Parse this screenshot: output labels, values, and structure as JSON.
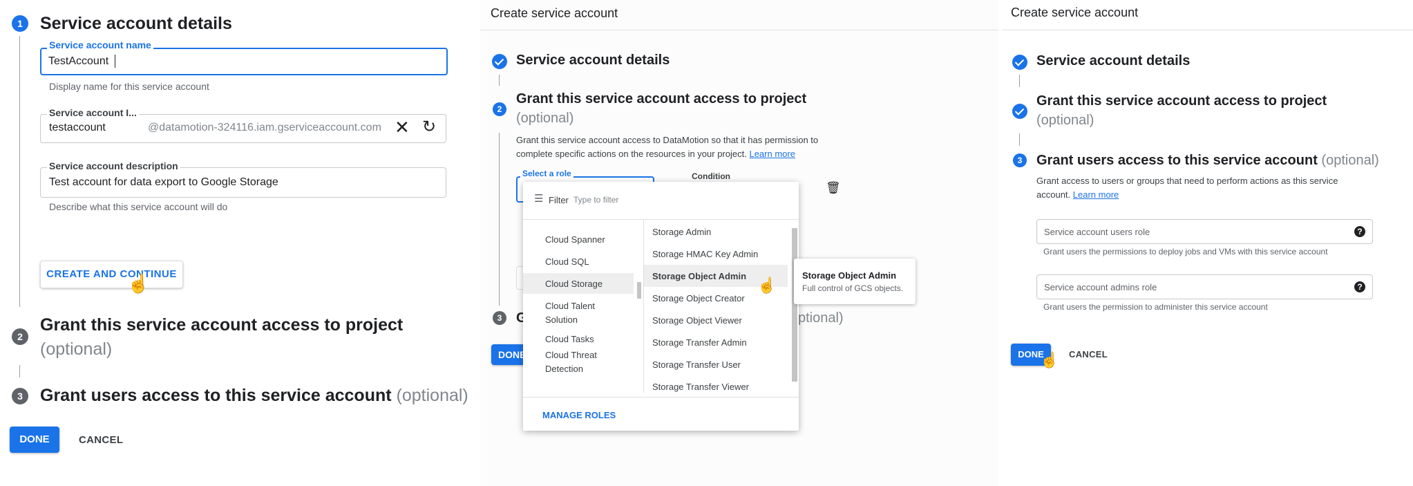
{
  "panel1": {
    "step1": {
      "number": "1",
      "title": "Service account details"
    },
    "name_field": {
      "label": "Service account name",
      "value": "TestAccount",
      "hint": "Display name for this service account"
    },
    "id_field": {
      "label": "Service account I...",
      "value": "testaccount",
      "suffix": "@datamotion-324116.iam.gserviceaccount.com"
    },
    "desc_field": {
      "label": "Service account description",
      "value": "Test account for data export to Google Storage",
      "hint": "Describe what this service account will do"
    },
    "create_continue_label": "CREATE AND CONTINUE",
    "step2": {
      "number": "2",
      "title": "Grant this service account access to project",
      "optional": "(optional)"
    },
    "step3": {
      "number": "3",
      "title": "Grant users access to this service account",
      "optional": "(optional)"
    },
    "done_label": "DONE",
    "cancel_label": "CANCEL"
  },
  "panel2": {
    "header": "Create service account",
    "step1_title": "Service account details",
    "step2": {
      "number": "2",
      "title": "Grant this service account access to project",
      "optional": "(optional)"
    },
    "description": "Grant this service account access to DataMotion so that it has permission to complete specific actions on the resources in your project.",
    "learn_more": "Learn more",
    "role_label": "Select a role",
    "condition_label": "Condition",
    "filter_label": "Filter",
    "filter_placeholder": "Type to filter",
    "categories": [
      "Cloud Spanner",
      "Cloud SQL",
      "Cloud Storage",
      "Cloud Talent Solution",
      "Cloud Tasks",
      "Cloud Threat Detection"
    ],
    "roles": [
      "Storage Admin",
      "Storage HMAC Key Admin",
      "Storage Object Admin",
      "Storage Object Creator",
      "Storage Object Viewer",
      "Storage Transfer Admin",
      "Storage Transfer User",
      "Storage Transfer Viewer"
    ],
    "tooltip": {
      "title": "Storage Object Admin",
      "body": "Full control of GCS objects."
    },
    "manage_roles": "MANAGE ROLES",
    "step3_number": "3",
    "step3_start": "G",
    "step3_end": "ptional)",
    "done_partial": "DONE"
  },
  "panel3": {
    "header": "Create service account",
    "step1_title": "Service account details",
    "step2": {
      "title": "Grant this service account access to project",
      "optional": "(optional)"
    },
    "step3": {
      "number": "3",
      "title": "Grant users access to this service account",
      "optional": "(optional)"
    },
    "description": "Grant access to users or groups that need to perform actions as this service account.",
    "learn_more": "Learn more",
    "users_role": {
      "placeholder": "Service account users role",
      "hint": "Grant users the permissions to deploy jobs and VMs with this service account"
    },
    "admins_role": {
      "placeholder": "Service account admins role",
      "hint": "Grant users the permission to administer this service account"
    },
    "done_label": "DONE",
    "cancel_label": "CANCEL"
  }
}
